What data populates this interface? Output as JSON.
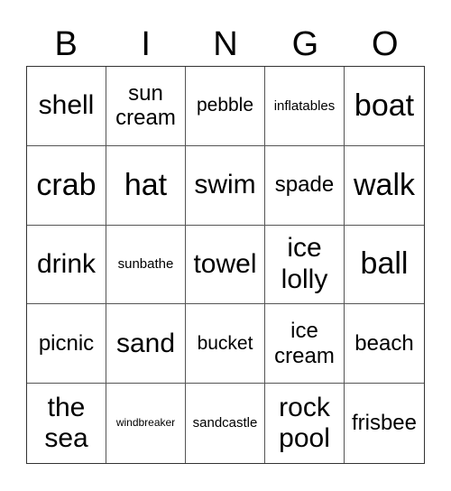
{
  "header": [
    "B",
    "I",
    "N",
    "G",
    "O"
  ],
  "cells": [
    [
      {
        "text": "shell",
        "size": "l"
      },
      {
        "text": "sun cream",
        "size": "m"
      },
      {
        "text": "pebble",
        "size": "s"
      },
      {
        "text": "inflatables",
        "size": "xs"
      },
      {
        "text": "boat",
        "size": "xl"
      }
    ],
    [
      {
        "text": "crab",
        "size": "xl"
      },
      {
        "text": "hat",
        "size": "xl"
      },
      {
        "text": "swim",
        "size": "l"
      },
      {
        "text": "spade",
        "size": "m"
      },
      {
        "text": "walk",
        "size": "xl"
      }
    ],
    [
      {
        "text": "drink",
        "size": "l"
      },
      {
        "text": "sunbathe",
        "size": "xs"
      },
      {
        "text": "towel",
        "size": "l"
      },
      {
        "text": "ice lolly",
        "size": "l"
      },
      {
        "text": "ball",
        "size": "xl"
      }
    ],
    [
      {
        "text": "picnic",
        "size": "m"
      },
      {
        "text": "sand",
        "size": "l"
      },
      {
        "text": "bucket",
        "size": "s"
      },
      {
        "text": "ice cream",
        "size": "m"
      },
      {
        "text": "beach",
        "size": "m"
      }
    ],
    [
      {
        "text": "the sea",
        "size": "l"
      },
      {
        "text": "windbreaker",
        "size": "xxs"
      },
      {
        "text": "sandcastle",
        "size": "xs"
      },
      {
        "text": "rock pool",
        "size": "l"
      },
      {
        "text": "frisbee",
        "size": "m"
      }
    ]
  ]
}
